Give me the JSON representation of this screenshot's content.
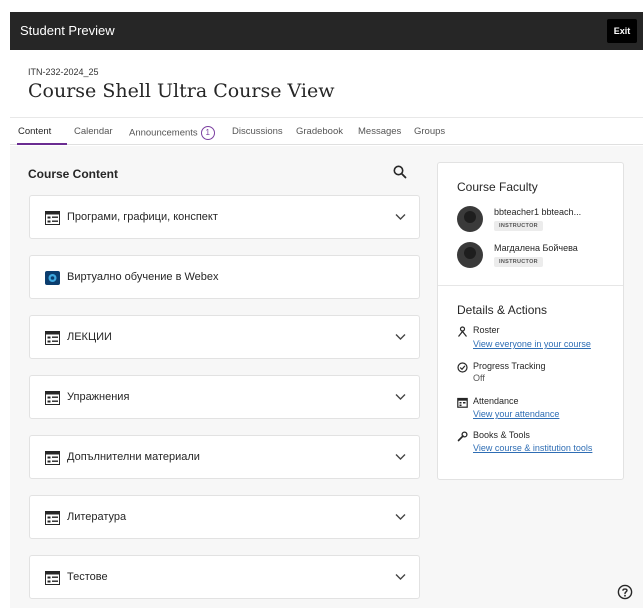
{
  "topbar": {
    "title": "Student Preview",
    "exit_label": "Exit"
  },
  "course": {
    "id": "ITN-232-2024_25",
    "title": "Course Shell Ultra Course View"
  },
  "tabs": [
    {
      "label": "Content"
    },
    {
      "label": "Calendar"
    },
    {
      "label": "Announcements",
      "badge": "1"
    },
    {
      "label": "Discussions"
    },
    {
      "label": "Gradebook"
    },
    {
      "label": "Messages"
    },
    {
      "label": "Groups"
    }
  ],
  "content": {
    "title": "Course Content",
    "items": [
      {
        "label": "Програми, графици, конспект",
        "icon": "folder-icon",
        "expandable": true
      },
      {
        "label": "Виртуално обучение в Webex",
        "icon": "webex-icon",
        "expandable": false
      },
      {
        "label": "ЛЕКЦИИ",
        "icon": "folder-icon",
        "expandable": true
      },
      {
        "label": "Упражнения",
        "icon": "folder-icon",
        "expandable": true
      },
      {
        "label": "Допълнителни материали",
        "icon": "folder-icon",
        "expandable": true
      },
      {
        "label": "Литература",
        "icon": "folder-icon",
        "expandable": true
      },
      {
        "label": "Тестове",
        "icon": "folder-icon",
        "expandable": true
      }
    ]
  },
  "faculty": {
    "title": "Course Faculty",
    "members": [
      {
        "name": "bbteacher1 bbteach...",
        "role": "INSTRUCTOR"
      },
      {
        "name": "Магдалена Бойчева",
        "role": "INSTRUCTOR"
      }
    ]
  },
  "details": {
    "title": "Details & Actions",
    "roster": {
      "name": "Roster",
      "link": "View everyone in your course"
    },
    "progress": {
      "name": "Progress Tracking",
      "value": "Off"
    },
    "attendance": {
      "name": "Attendance",
      "link": "View your attendance"
    },
    "books": {
      "name": "Books & Tools",
      "link": "View course & institution tools"
    }
  },
  "colors": {
    "accent": "#6a2c91",
    "link": "#2e6db4",
    "topbar": "#262626"
  }
}
